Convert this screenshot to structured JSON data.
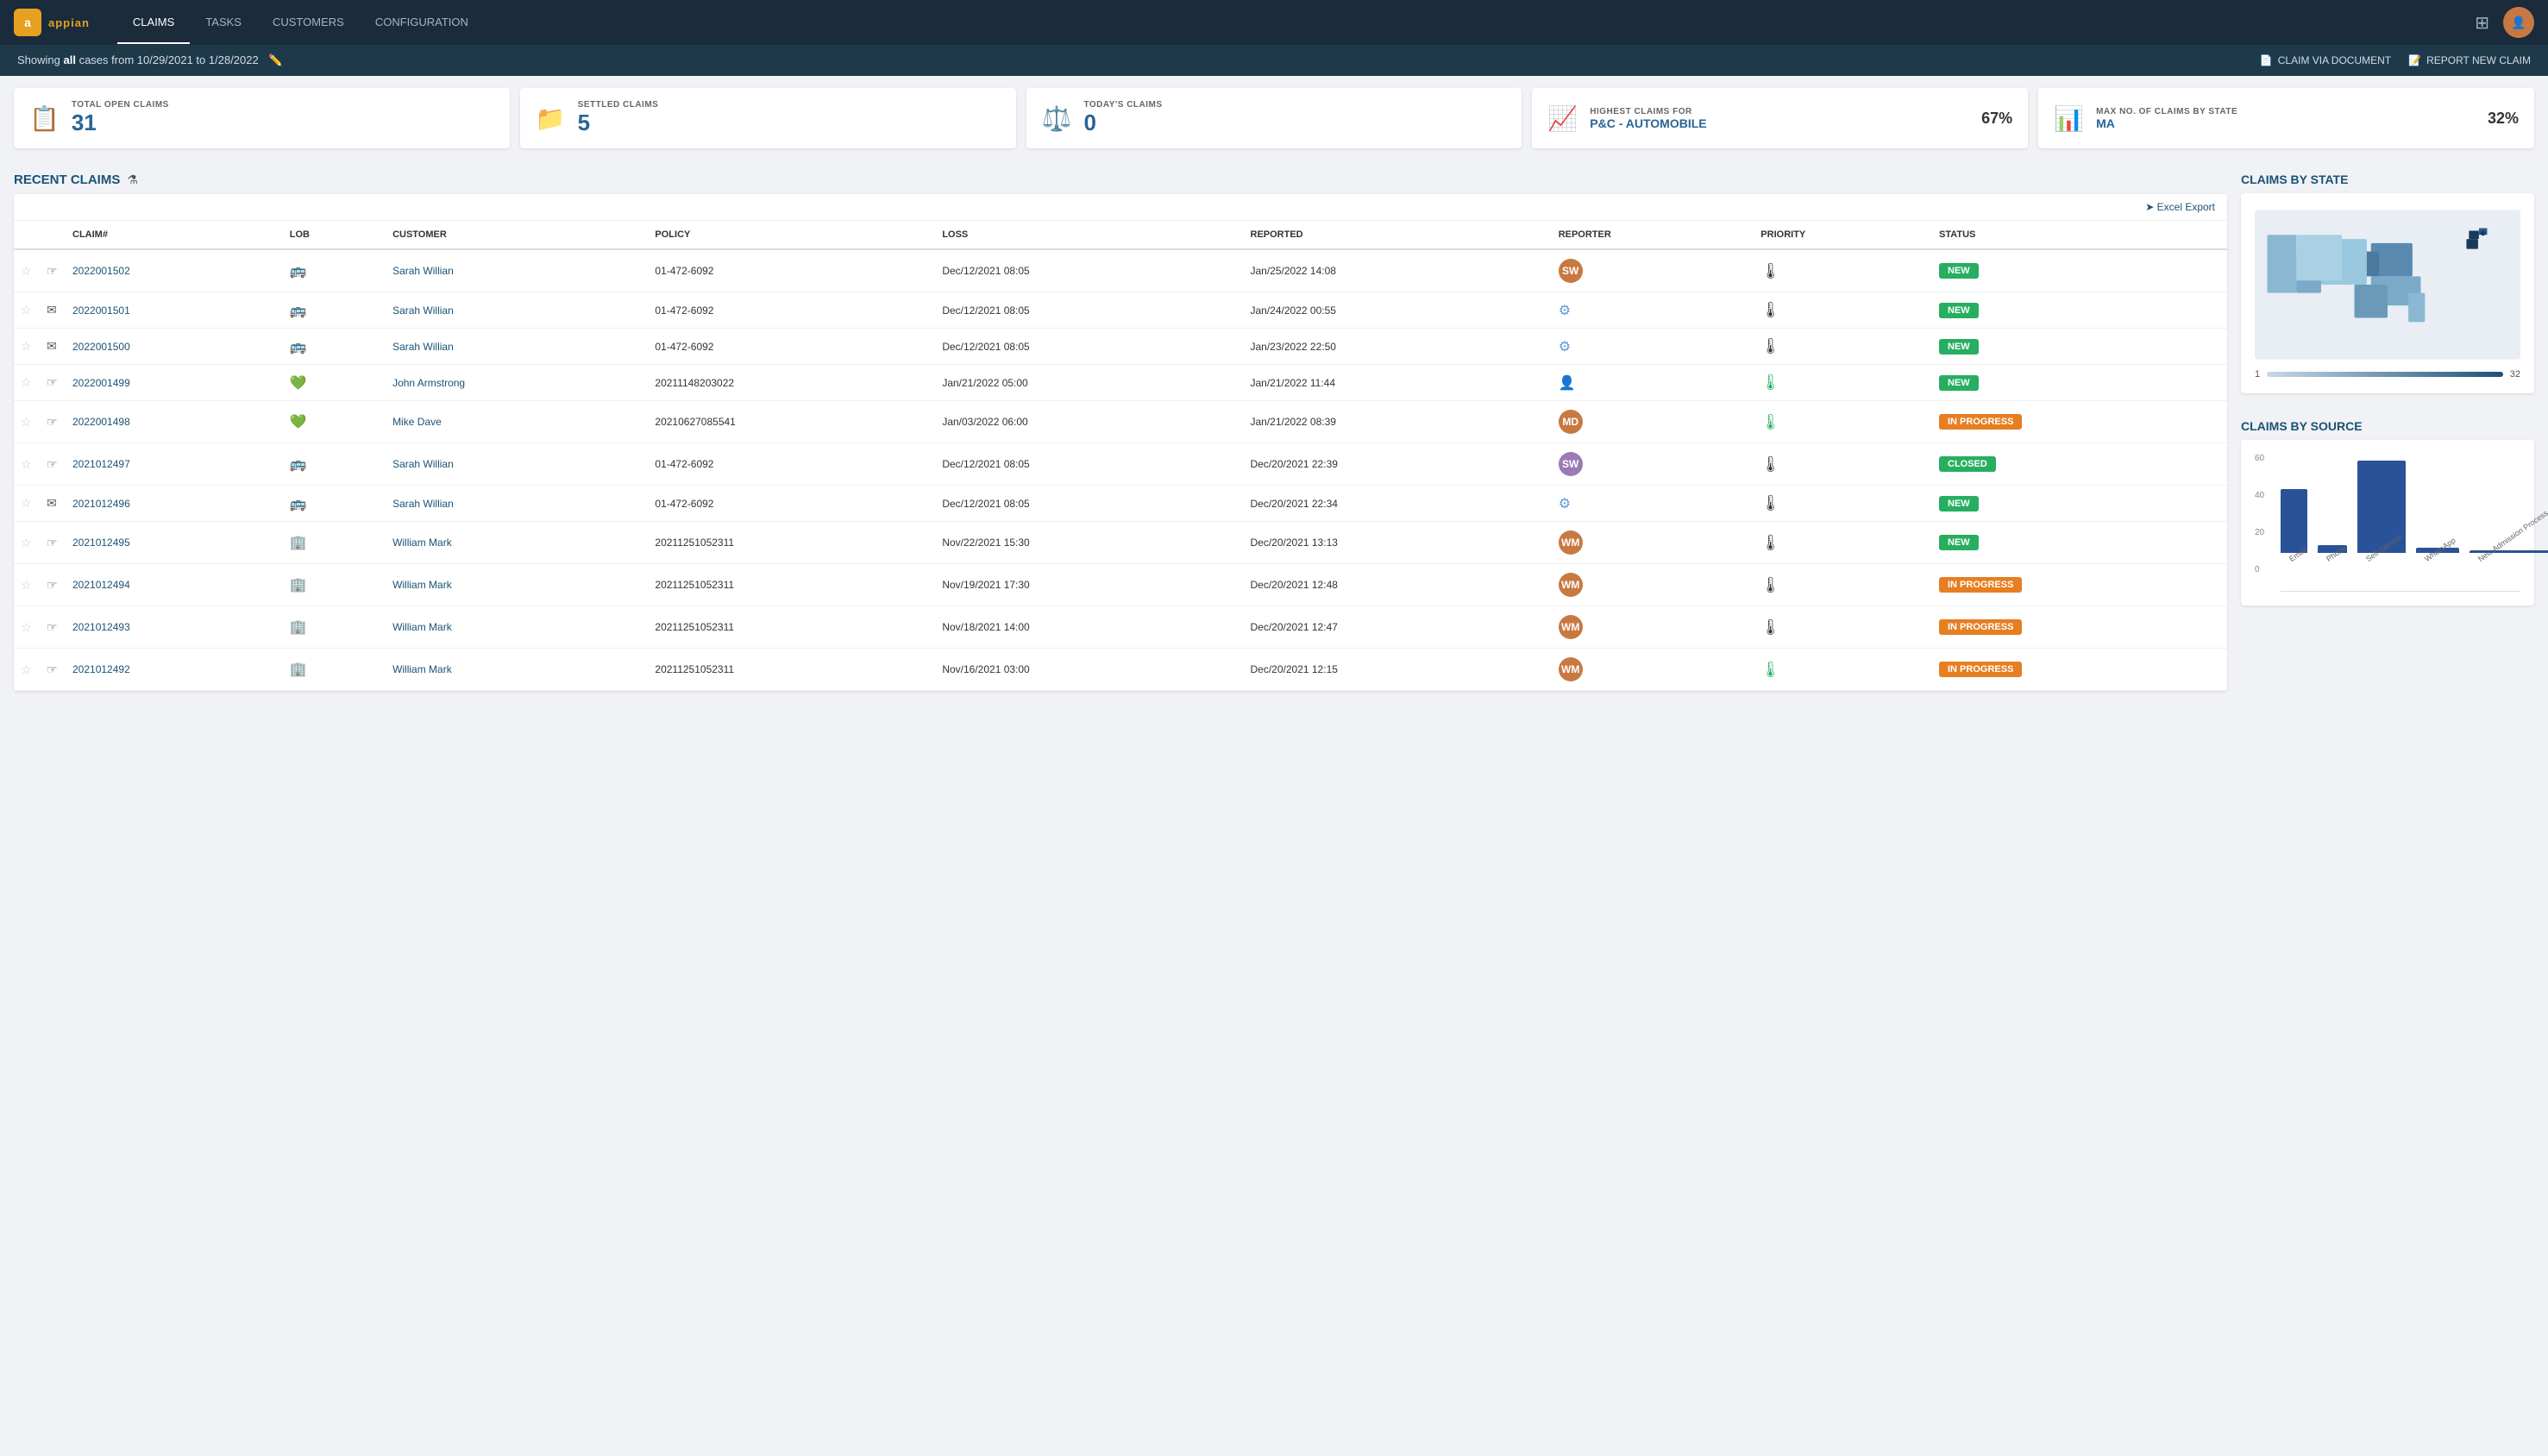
{
  "app": {
    "logo_text": "appian",
    "logo_initials": "a"
  },
  "nav": {
    "links": [
      {
        "label": "CLAIMS",
        "active": true
      },
      {
        "label": "TASKS",
        "active": false
      },
      {
        "label": "CUSTOMERS",
        "active": false
      },
      {
        "label": "CONFIGURATION",
        "active": false
      }
    ]
  },
  "subheader": {
    "showing_text": "Showing ",
    "showing_bold": "all",
    "showing_dates": " cases from 10/29/2021 to 1/28/2022",
    "btn_document": "CLAIM VIA DOCUMENT",
    "btn_new": "REPORT NEW CLAIM"
  },
  "kpis": [
    {
      "label": "TOTAL OPEN CLAIMS",
      "value": "31",
      "value_type": "number",
      "icon": "📋",
      "pct": ""
    },
    {
      "label": "SETTLED CLAIMS",
      "value": "5",
      "value_type": "number",
      "icon": "📁",
      "pct": ""
    },
    {
      "label": "TODAY'S CLAIMS",
      "value": "0",
      "value_type": "number",
      "icon": "⚖️",
      "pct": ""
    },
    {
      "label": "HIGHEST CLAIMS FOR",
      "value": "P&C - AUTOMOBILE",
      "value_type": "text",
      "icon": "📈",
      "pct": "67%"
    },
    {
      "label": "MAX NO. OF CLAIMS BY STATE",
      "value": "MA",
      "value_type": "text",
      "icon": "📊",
      "pct": "32%"
    }
  ],
  "recent_claims": {
    "title": "RECENT CLAIMS",
    "export_label": "➤ Excel Export",
    "columns": [
      "",
      "",
      "CLAIM#",
      "LOB",
      "CUSTOMER",
      "POLICY",
      "LOSS",
      "REPORTED",
      "REPORTER",
      "PRIORITY",
      "STATUS"
    ],
    "rows": [
      {
        "id": "1",
        "starred": false,
        "icon_type": "hand",
        "claim_num": "2022001502",
        "lob": "bus",
        "customer": "Sarah Willian",
        "policy": "01-472-6092",
        "loss": "Dec/12/2021 08:05",
        "reported": "Jan/25/2022 14:08",
        "reporter_type": "avatar",
        "reporter_color": "#c87941",
        "reporter_initials": "SW",
        "priority_level": "medium",
        "priority_color": "black",
        "status": "NEW",
        "status_type": "new"
      },
      {
        "id": "2",
        "starred": false,
        "icon_type": "email",
        "claim_num": "2022001501",
        "lob": "bus",
        "customer": "Sarah Willian",
        "policy": "01-472-6092",
        "loss": "Dec/12/2021 08:05",
        "reported": "Jan/24/2022 00:55",
        "reporter_type": "gear",
        "reporter_color": "#5b9bd5",
        "reporter_initials": "",
        "priority_level": "medium",
        "priority_color": "black",
        "status": "NEW",
        "status_type": "new"
      },
      {
        "id": "3",
        "starred": false,
        "icon_type": "email",
        "claim_num": "2022001500",
        "lob": "bus",
        "customer": "Sarah Willian",
        "policy": "01-472-6092",
        "loss": "Dec/12/2021 08:05",
        "reported": "Jan/23/2022 22:50",
        "reporter_type": "gear",
        "reporter_color": "#5b9bd5",
        "reporter_initials": "",
        "priority_level": "medium",
        "priority_color": "black",
        "status": "NEW",
        "status_type": "new"
      },
      {
        "id": "4",
        "starred": false,
        "icon_type": "hand",
        "claim_num": "2022001499",
        "lob": "heart",
        "customer": "John Armstrong",
        "policy": "20211148203022",
        "loss": "Jan/21/2022 05:00",
        "reported": "Jan/21/2022 11:44",
        "reporter_type": "person",
        "reporter_color": "#aaa",
        "reporter_initials": "",
        "priority_level": "low",
        "priority_color": "green",
        "status": "NEW",
        "status_type": "new"
      },
      {
        "id": "5",
        "starred": false,
        "icon_type": "hand",
        "claim_num": "2022001498",
        "lob": "heart",
        "customer": "Mike Dave",
        "policy": "20210627085541",
        "loss": "Jan/03/2022 06:00",
        "reported": "Jan/21/2022 08:39",
        "reporter_type": "avatar",
        "reporter_color": "#c87941",
        "reporter_initials": "MD",
        "priority_level": "low",
        "priority_color": "green",
        "status": "IN PROGRESS",
        "status_type": "inprogress"
      },
      {
        "id": "6",
        "starred": false,
        "icon_type": "hand",
        "claim_num": "2021012497",
        "lob": "bus",
        "customer": "Sarah Willian",
        "policy": "01-472-6092",
        "loss": "Dec/12/2021 08:05",
        "reported": "Dec/20/2021 22:39",
        "reporter_type": "avatar",
        "reporter_color": "#9b7ab5",
        "reporter_initials": "SW",
        "priority_level": "medium",
        "priority_color": "black",
        "status": "CLOSED",
        "status_type": "closed"
      },
      {
        "id": "7",
        "starred": false,
        "icon_type": "email",
        "claim_num": "2021012496",
        "lob": "bus",
        "customer": "Sarah Willian",
        "policy": "01-472-6092",
        "loss": "Dec/12/2021 08:05",
        "reported": "Dec/20/2021 22:34",
        "reporter_type": "gear",
        "reporter_color": "#5b9bd5",
        "reporter_initials": "",
        "priority_level": "medium",
        "priority_color": "black",
        "status": "NEW",
        "status_type": "new"
      },
      {
        "id": "8",
        "starred": false,
        "icon_type": "hand",
        "claim_num": "2021012495",
        "lob": "building",
        "customer": "William Mark",
        "policy": "20211251052311",
        "loss": "Nov/22/2021 15:30",
        "reported": "Dec/20/2021 13:13",
        "reporter_type": "avatar",
        "reporter_color": "#c87941",
        "reporter_initials": "WM",
        "priority_level": "medium",
        "priority_color": "black",
        "status": "NEW",
        "status_type": "new"
      },
      {
        "id": "9",
        "starred": false,
        "icon_type": "hand",
        "claim_num": "2021012494",
        "lob": "building",
        "customer": "William Mark",
        "policy": "20211251052311",
        "loss": "Nov/19/2021 17:30",
        "reported": "Dec/20/2021 12:48",
        "reporter_type": "avatar",
        "reporter_color": "#c87941",
        "reporter_initials": "WM",
        "priority_level": "medium",
        "priority_color": "black",
        "status": "IN PROGRESS",
        "status_type": "inprogress"
      },
      {
        "id": "10",
        "starred": false,
        "icon_type": "hand",
        "claim_num": "2021012493",
        "lob": "building",
        "customer": "William Mark",
        "policy": "20211251052311",
        "loss": "Nov/18/2021 14:00",
        "reported": "Dec/20/2021 12:47",
        "reporter_type": "avatar",
        "reporter_color": "#c87941",
        "reporter_initials": "WM",
        "priority_level": "medium",
        "priority_color": "black",
        "status": "IN PROGRESS",
        "status_type": "inprogress"
      },
      {
        "id": "11",
        "starred": false,
        "icon_type": "hand",
        "claim_num": "2021012492",
        "lob": "building",
        "customer": "William Mark",
        "policy": "20211251052311",
        "loss": "Nov/16/2021 03:00",
        "reported": "Dec/20/2021 12:15",
        "reporter_type": "avatar",
        "reporter_color": "#c87941",
        "reporter_initials": "WM",
        "priority_level": "low",
        "priority_color": "green",
        "status": "IN PROGRESS",
        "status_type": "inprogress"
      }
    ]
  },
  "claims_by_state": {
    "title": "CLAIMS BY STATE",
    "range_min": "1",
    "range_max": "32"
  },
  "claims_by_source": {
    "title": "CLAIMS BY SOURCE",
    "y_labels": [
      "60",
      "40",
      "20",
      "0"
    ],
    "bars": [
      {
        "label": "Email",
        "value": 40,
        "height_pct": 67
      },
      {
        "label": "Phone",
        "value": 5,
        "height_pct": 8
      },
      {
        "label": "Self-Service",
        "value": 58,
        "height_pct": 97
      },
      {
        "label": "WhatsApp",
        "value": 3,
        "height_pct": 5
      },
      {
        "label": "New Admission Process",
        "value": 2,
        "height_pct": 3
      }
    ]
  }
}
